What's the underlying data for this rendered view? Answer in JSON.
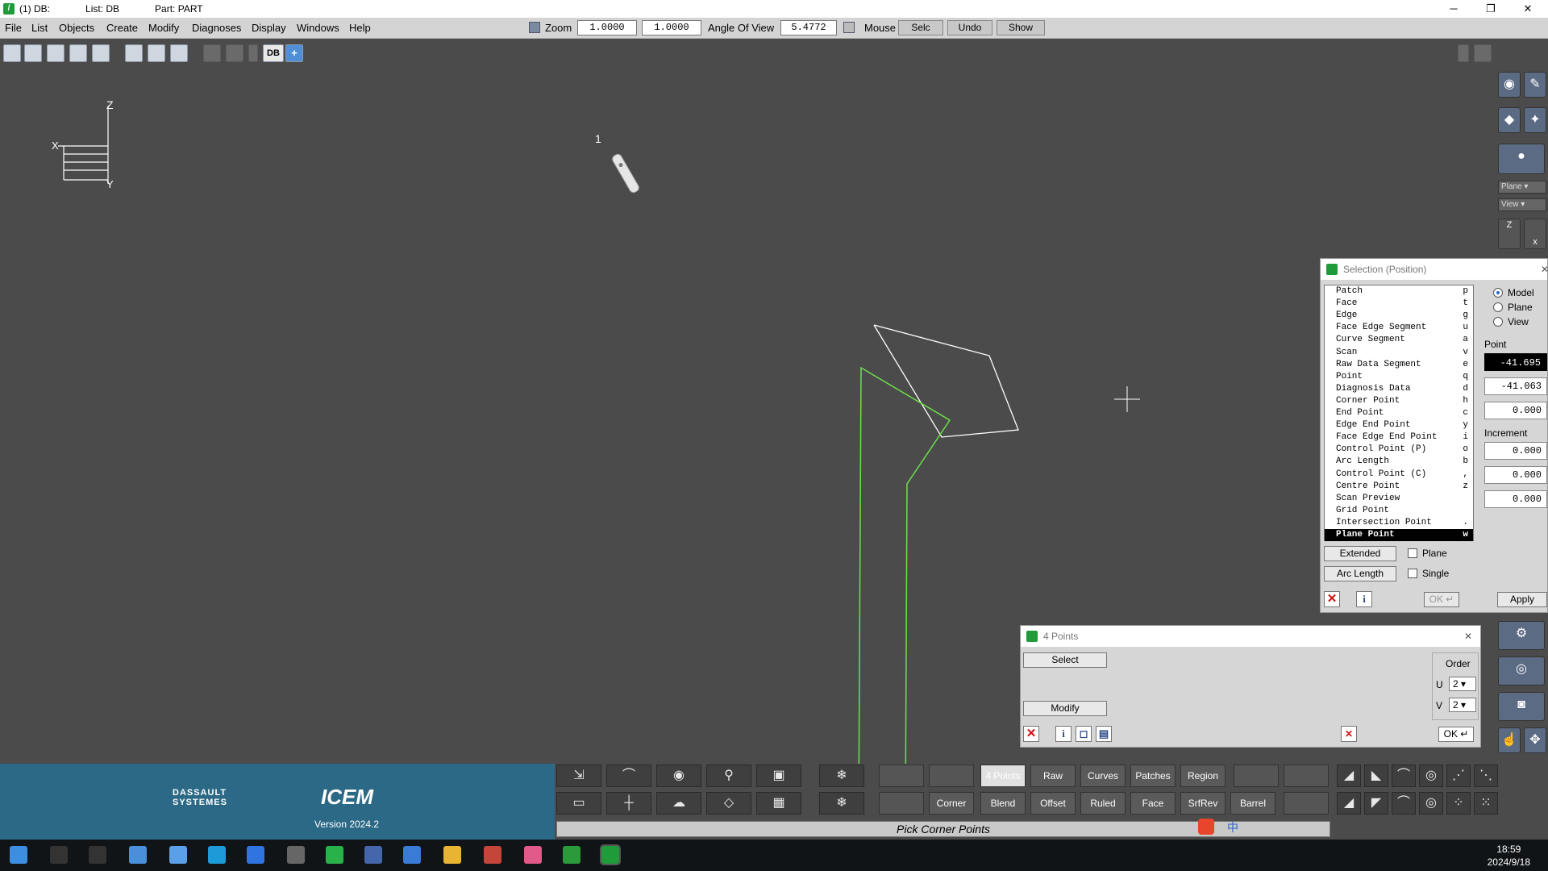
{
  "titlebar": {
    "db": "(1) DB:",
    "list": "List: DB",
    "part": "Part: PART",
    "minimize": "─",
    "restore": "❐",
    "close": "✕"
  },
  "menu": [
    "File",
    "List",
    "Objects",
    "Create",
    "Modify",
    "Diagnoses",
    "Display",
    "Windows",
    "Help"
  ],
  "toolbar": {
    "zoom_label": "Zoom",
    "zoom1": "1.0000",
    "zoom2": "1.0000",
    "aov_label": "Angle Of View",
    "aov_value": "5.4772",
    "mouse_label": "Mouse",
    "selc": "Selc",
    "undo": "Undo",
    "show": "Show"
  },
  "iconbar": {
    "db_label": "DB"
  },
  "viewport": {
    "triad": {
      "z": "Z",
      "x": "X",
      "y": "Y"
    },
    "marker_label": "1"
  },
  "right_palette": {
    "plane_select": "Plane",
    "view_select": "View",
    "z_axis": "Z",
    "x_axis": "x"
  },
  "selection_dialog": {
    "title": "Selection (Position)",
    "items": [
      {
        "label": "Patch",
        "key": "p"
      },
      {
        "label": "Face",
        "key": "t"
      },
      {
        "label": "Edge",
        "key": "g"
      },
      {
        "label": "Face Edge Segment",
        "key": "u"
      },
      {
        "label": "Curve Segment",
        "key": "a"
      },
      {
        "label": "Scan",
        "key": "v"
      },
      {
        "label": "Raw Data Segment",
        "key": "e"
      },
      {
        "label": "Point",
        "key": "q"
      },
      {
        "label": "Diagnosis Data",
        "key": "d"
      },
      {
        "label": "Corner Point",
        "key": "h"
      },
      {
        "label": "End Point",
        "key": "c"
      },
      {
        "label": "Edge End Point",
        "key": "y"
      },
      {
        "label": "Face Edge End Point",
        "key": "i"
      },
      {
        "label": "Control Point (P)",
        "key": "o"
      },
      {
        "label": "Arc Length",
        "key": "b"
      },
      {
        "label": "Control Point (C)",
        "key": ","
      },
      {
        "label": "Centre Point",
        "key": "z"
      },
      {
        "label": "Scan Preview",
        "key": ""
      },
      {
        "label": "Grid Point",
        "key": ""
      },
      {
        "label": "Intersection Point",
        "key": "."
      },
      {
        "label": "Plane Point",
        "key": "w"
      }
    ],
    "selected_index": 20,
    "radios": [
      "Model",
      "Plane",
      "View"
    ],
    "radio_selected": "Model",
    "point_label": "Point",
    "point_values": [
      "-41.695",
      "-41.063",
      "0.000"
    ],
    "increment_label": "Increment",
    "increment_values": [
      "0.000",
      "0.000",
      "0.000"
    ],
    "extended_btn": "Extended",
    "arclength_btn": "Arc Length",
    "plane_chk": "Plane",
    "single_chk": "Single",
    "ok_btn": "OK ↵",
    "apply_btn": "Apply"
  },
  "points_dialog": {
    "title": "4 Points",
    "select_btn": "Select",
    "modify_btn": "Modify",
    "order_label": "Order",
    "u_label": "U",
    "v_label": "V",
    "u_value": "2",
    "v_value": "2",
    "ok_btn": "OK ↵"
  },
  "brand": {
    "dassault_line1": "DASSAULT",
    "dassault_line2": "SYSTEMES",
    "icem": "ICEM",
    "version": "Version 2024.2"
  },
  "commands": {
    "row1": [
      "4 Points",
      "Raw",
      "Curves",
      "Patches",
      "Region"
    ],
    "row2": [
      "Corner",
      "Blend",
      "Offset",
      "Ruled",
      "Face",
      "SrfRev",
      "Barrel"
    ],
    "active": "4 Points"
  },
  "prompt": "Pick Corner Points",
  "taskbar": {
    "time": "18:59",
    "date": "2024/9/18",
    "ime": "中"
  },
  "colors": {
    "viewport_bg": "#4b4b4b",
    "curve_green": "#6ee04a",
    "brand_blue": "#2c6986",
    "geometry_white": "#ffffff"
  }
}
